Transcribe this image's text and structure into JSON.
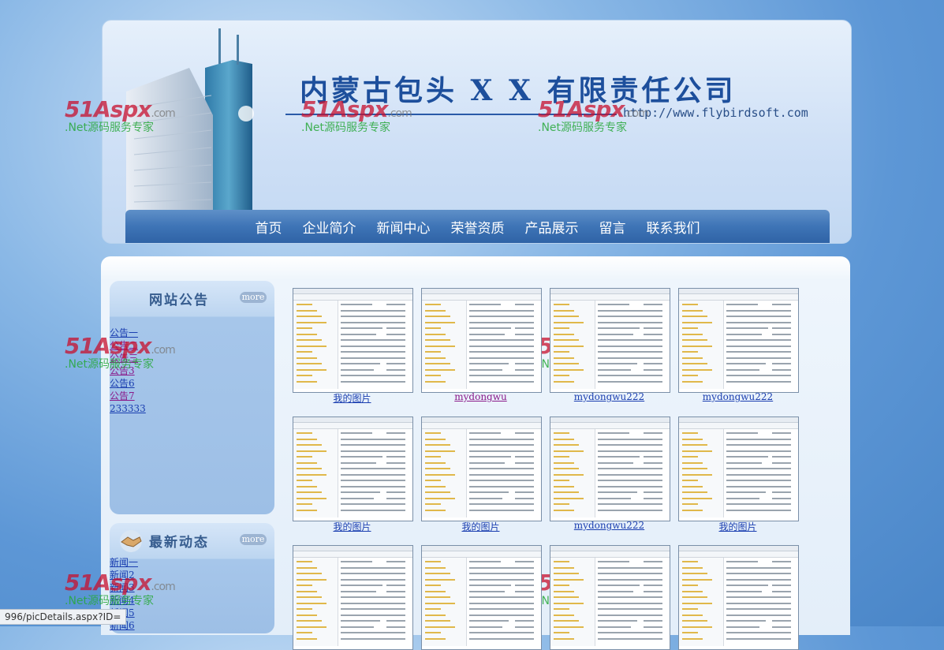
{
  "header": {
    "company_name": "内蒙古包头 X X 有限责任公司",
    "website": "http://www.flybirdsoft.com"
  },
  "nav": {
    "items": [
      "首页",
      "企业简介",
      "新闻中心",
      "荣誉资质",
      "产品展示",
      "留言",
      "联系我们"
    ]
  },
  "sidebar": {
    "announcements": {
      "title": "网站公告",
      "more": "more",
      "items": [
        "公告一",
        "公告二",
        "公告三",
        "公告3",
        "公告6",
        "公告7",
        "233333"
      ]
    },
    "news": {
      "title": "最新动态",
      "more": "more",
      "items": [
        "新闻一",
        "新闻2",
        "新闻3",
        "新闻4",
        "新闻5",
        "新闻6"
      ]
    }
  },
  "gallery": {
    "rows": [
      [
        "我的图片",
        "mydongwu",
        "mydongwu222",
        "mydongwu222"
      ],
      [
        "我的图片",
        "我的图片",
        "mydongwu222",
        "我的图片"
      ]
    ]
  },
  "watermark": {
    "logo": "51Aspx",
    "domain": ".com",
    "tagline": ".Net源码服务专家"
  },
  "status": {
    "url": "996/picDetails.aspx?ID="
  }
}
